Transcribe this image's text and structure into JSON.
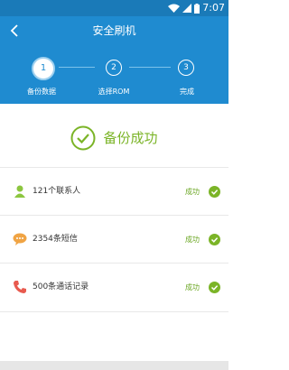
{
  "status_bar": {
    "time": "7:07"
  },
  "header": {
    "title": "安全刷机"
  },
  "steps": [
    {
      "number": "1",
      "label": "备份数据",
      "active": true
    },
    {
      "number": "2",
      "label": "选择ROM",
      "active": false
    },
    {
      "number": "3",
      "label": "完成",
      "active": false
    }
  ],
  "result": {
    "message": "备份成功"
  },
  "items": [
    {
      "icon": "contact-icon",
      "label": "121个联系人",
      "status": "成功"
    },
    {
      "icon": "sms-icon",
      "label": "2354条短信",
      "status": "成功"
    },
    {
      "icon": "phone-icon",
      "label": "500条通话记录",
      "status": "成功"
    }
  ],
  "colors": {
    "header": "#1f8bd0",
    "status_bar": "#1a7ab8",
    "success": "#7bb427"
  }
}
